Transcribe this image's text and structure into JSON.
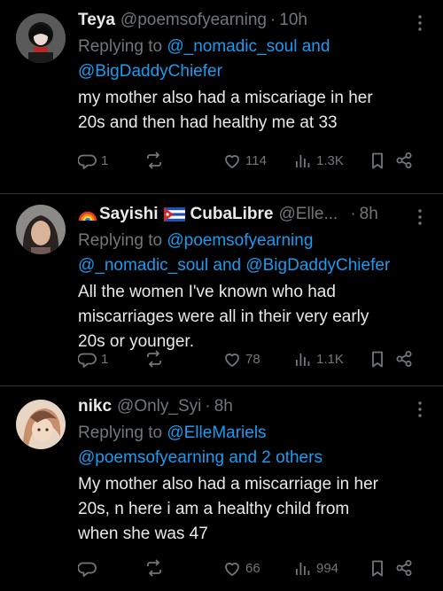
{
  "tweets": [
    {
      "name": "Teya",
      "handle": "@poemsofyearning",
      "time": "10h",
      "replying_prefix": "Replying to",
      "replying_line1": "@_nomadic_soul and",
      "replying_line2": "@BigDaddyChiefer",
      "text_lines": [
        "my mother also had a miscariage in her",
        "20s and then had healthy me at 33"
      ],
      "replies": "1",
      "retweets": "",
      "likes": "114",
      "views": "1.3K",
      "avatar": "dark-hooded-avatar"
    },
    {
      "name_prefix_emoji": "rainbow",
      "name": "Sayishi",
      "name_flag": "cuba-flag",
      "name_suffix": "CubaLibre",
      "handle": "@Elle...",
      "time": "8h",
      "replying_prefix": "Replying to",
      "replying_line1": "@poemsofyearning",
      "replying_line2": "@_nomadic_soul and @BigDaddyChiefer",
      "text_lines": [
        "All the women I've known who had",
        "miscarriages were all in their very early",
        "20s or younger."
      ],
      "replies": "1",
      "retweets": "",
      "likes": "78",
      "views": "1.1K",
      "avatar": "woman-avatar"
    },
    {
      "name": "nikc",
      "handle": "@Only_Syi",
      "time": "8h",
      "replying_prefix": "Replying to",
      "replying_line1": "@ElleMariels",
      "replying_line2": "@poemsofyearning and 2 others",
      "text_lines": [
        "My mother also had a miscarriage in her",
        "20s, n here i am  a healthy child from",
        "when she was 47"
      ],
      "replies": "",
      "retweets": "",
      "likes": "66",
      "views": "994",
      "avatar": "illustrated-avatar"
    }
  ],
  "colors": {
    "accent": "#1d9bf0",
    "muted": "#71767b",
    "text": "#e7e9ea",
    "bg": "#000000"
  }
}
